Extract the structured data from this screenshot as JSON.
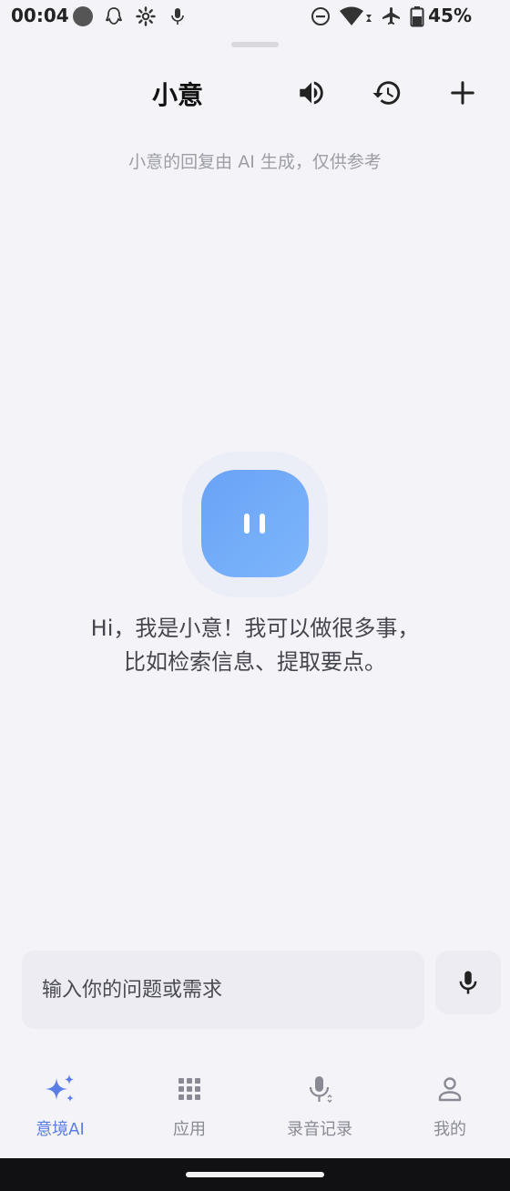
{
  "status_bar": {
    "time": "00:04",
    "battery_percent": "45%",
    "icons": [
      "record-dot-icon",
      "qq-icon",
      "settings-icon",
      "mic-small-icon",
      "dnd-icon",
      "wifi-icon",
      "airplane-icon",
      "battery-icon"
    ]
  },
  "header": {
    "title": "小意",
    "actions": [
      "speaker-icon",
      "history-icon",
      "add-icon"
    ]
  },
  "subtitle": "小意的回复由 AI 生成，仅供参考",
  "greeting": {
    "line1": "Hi，我是小意！我可以做很多事，",
    "line2": "比如检索信息、提取要点。"
  },
  "input": {
    "placeholder": "输入你的问题或需求",
    "value": ""
  },
  "nav": {
    "items": [
      {
        "label": "意境AI",
        "icon": "sparkle-icon",
        "active": true
      },
      {
        "label": "应用",
        "icon": "grid-icon",
        "active": false
      },
      {
        "label": "录音记录",
        "icon": "mic-record-icon",
        "active": false
      },
      {
        "label": "我的",
        "icon": "person-icon",
        "active": false
      }
    ]
  },
  "colors": {
    "accent": "#5a7ee6",
    "avatar": "#73abf8",
    "background": "#f3f3f8"
  }
}
